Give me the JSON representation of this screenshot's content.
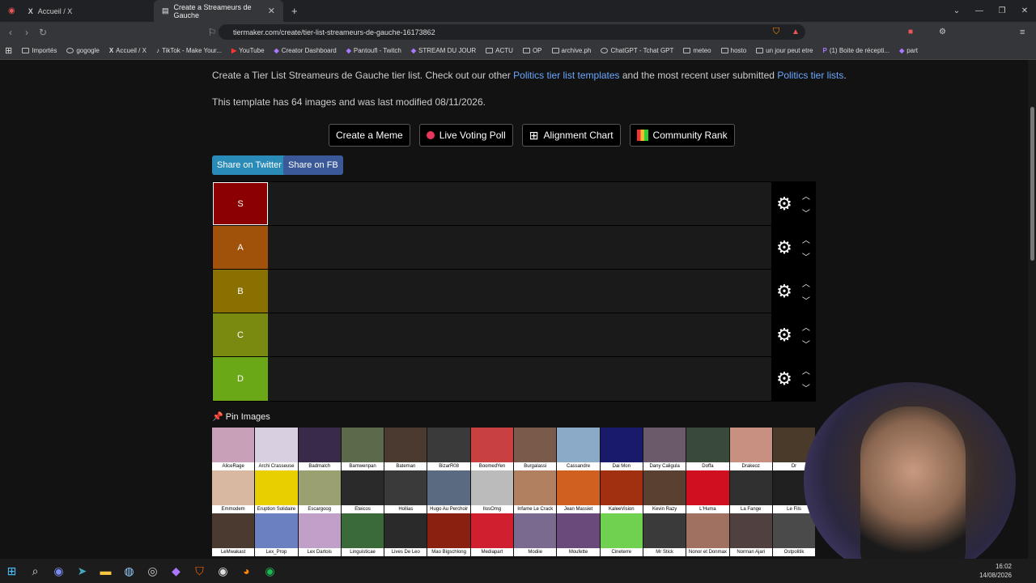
{
  "browser": {
    "tabs": [
      {
        "label": "Accueil / X",
        "active": false
      },
      {
        "label": "Create a Streameurs de Gauche",
        "active": true
      }
    ],
    "url": "tiermaker.com/create/tier-list-streameurs-de-gauche-16173862",
    "bookmarks": [
      "Importés",
      "gogogle",
      "Accueil / X",
      "TikTok - Make Your...",
      "YouTube",
      "Creator Dashboard",
      "Pantoufl - Twitch",
      "STREAM DU JOUR",
      "ACTU",
      "OP",
      "archive.ph",
      "ChatGPT - Tchat GPT",
      "meteo",
      "hosto",
      "un jour peut etre",
      "(1) Boite de récepti...",
      "part"
    ]
  },
  "page": {
    "intro_pre": "Create a Tier List Streameurs de Gauche tier list. Check out our other ",
    "intro_link1": "Politics tier list templates",
    "intro_mid": " and the most recent user submitted ",
    "intro_link2": "Politics tier lists",
    "intro_end": ".",
    "template_info": "This template has 64 images and was last modified 08/11/2026.",
    "actions": [
      "Create a Meme",
      "Live Voting Poll",
      "Alignment Chart",
      "Community Rank"
    ],
    "share_twitter": "Share on Twitter",
    "share_fb": "Share on FB",
    "pin_label": "Pin Images"
  },
  "tiers": [
    {
      "label": "S",
      "color": "#8b0000"
    },
    {
      "label": "A",
      "color": "#a0520a"
    },
    {
      "label": "B",
      "color": "#8a7000"
    },
    {
      "label": "C",
      "color": "#7a8a10"
    },
    {
      "label": "D",
      "color": "#6aa818"
    }
  ],
  "images": [
    {
      "name": "AliceRage",
      "color": "#c8a0b8"
    },
    {
      "name": "Archi Crasseuse",
      "color": "#d8d0e0"
    },
    {
      "name": "Badmalch",
      "color": "#3a2a4a"
    },
    {
      "name": "Bamwenpan",
      "color": "#5a6a4a"
    },
    {
      "name": "Bateman",
      "color": "#4a3a30"
    },
    {
      "name": "BizarR08",
      "color": "#3a3a3a"
    },
    {
      "name": "BoomedYen",
      "color": "#c84040"
    },
    {
      "name": "Burgalassi",
      "color": "#7a5a4a"
    },
    {
      "name": "Cassandre",
      "color": "#8aaac8"
    },
    {
      "name": "Dai Mon",
      "color": "#1a1a6a"
    },
    {
      "name": "Dany Caligula",
      "color": "#6a5a6a"
    },
    {
      "name": "Doffa",
      "color": "#3a4a3a"
    },
    {
      "name": "Drakeoz",
      "color": "#c89080"
    },
    {
      "name": "Dr",
      "color": "#4a3a2a"
    },
    {
      "name": "Emmodem",
      "color": "#d8b8a0"
    },
    {
      "name": "Eruption Solidaire",
      "color": "#e8d000"
    },
    {
      "name": "Escargoog",
      "color": "#9aa070"
    },
    {
      "name": "Eteicos",
      "color": "#2a2a2a"
    },
    {
      "name": "Hollias",
      "color": "#3a3a3a"
    },
    {
      "name": "Hugo Au Perchoir",
      "color": "#5a6a80"
    },
    {
      "name": "IlosOmg",
      "color": "#bbbbbb"
    },
    {
      "name": "Infame Le Crack",
      "color": "#b08060"
    },
    {
      "name": "Jean Massiet",
      "color": "#d06020"
    },
    {
      "name": "KaleeVision",
      "color": "#a03010"
    },
    {
      "name": "Kevin Razy",
      "color": "#5a4030"
    },
    {
      "name": "L'Huma",
      "color": "#d01020"
    },
    {
      "name": "La Fange",
      "color": "#303030"
    },
    {
      "name": "Le Fils",
      "color": "#202020"
    },
    {
      "name": "LeMwakast",
      "color": "#4a3a30"
    },
    {
      "name": "Lex_Prop",
      "color": "#6a80c0"
    },
    {
      "name": "Lex Dartois",
      "color": "#c0a0c8"
    },
    {
      "name": "Linguisticae",
      "color": "#3a6a3a"
    },
    {
      "name": "Lives De Leo",
      "color": "#2a2a2a"
    },
    {
      "name": "Mao Bigschlong",
      "color": "#8a2010"
    },
    {
      "name": "Mediapart",
      "color": "#d02030"
    },
    {
      "name": "Modiie",
      "color": "#7a6a90"
    },
    {
      "name": "Moufette",
      "color": "#6a4a7a"
    },
    {
      "name": "Cineterre",
      "color": "#70d050"
    },
    {
      "name": "Mr Stick",
      "color": "#3a3a3a"
    },
    {
      "name": "Nonor et Donmax",
      "color": "#a07060"
    },
    {
      "name": "Norman Ajari",
      "color": "#504040"
    },
    {
      "name": "Ostpolitik",
      "color": "#4a4a4a"
    }
  ],
  "clock": {
    "time": "16:02",
    "date": "14/08/2026"
  }
}
